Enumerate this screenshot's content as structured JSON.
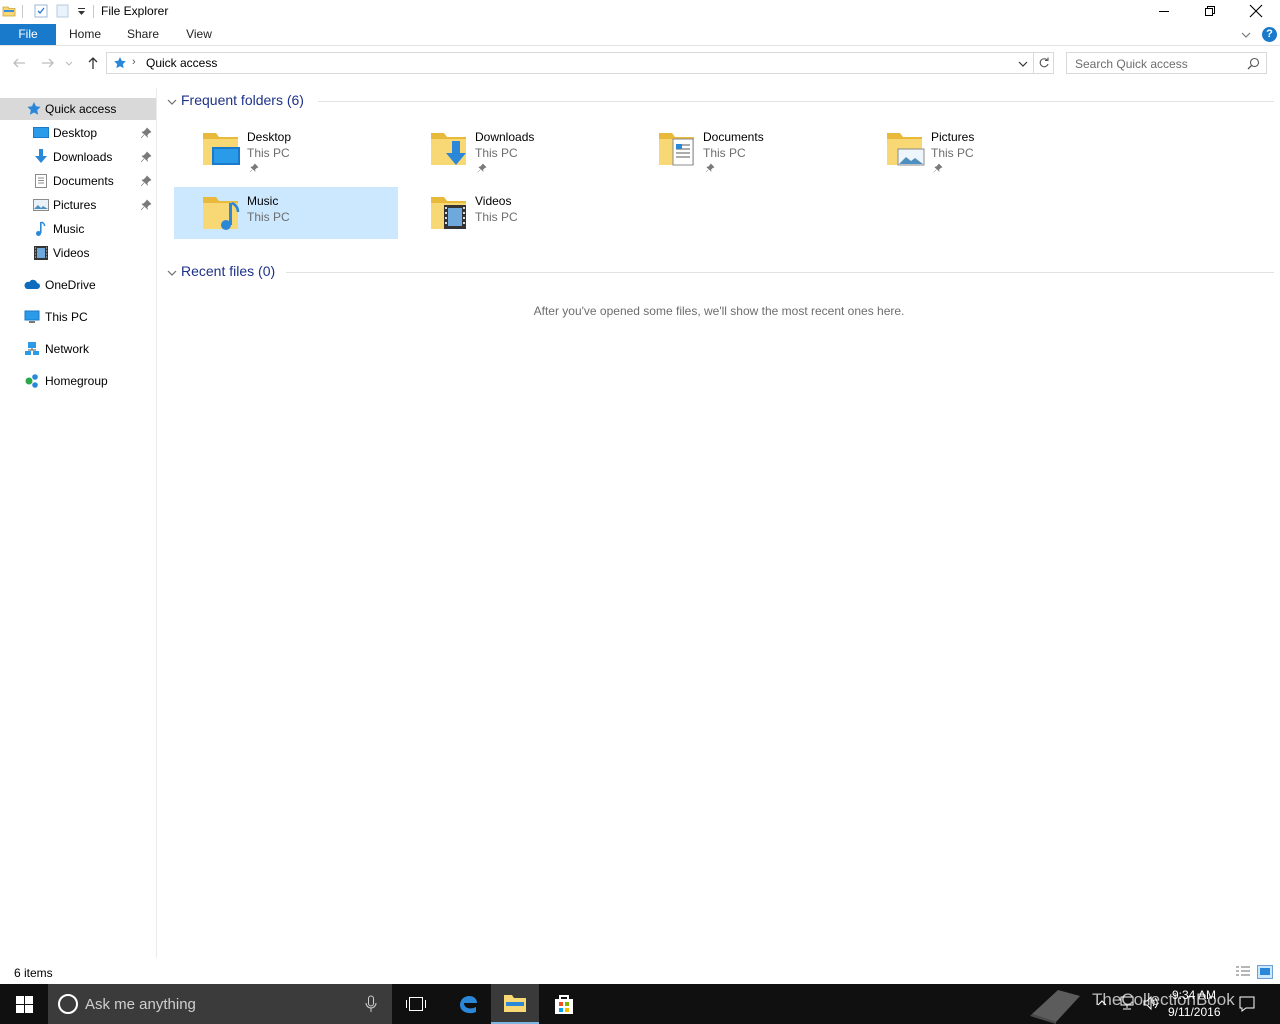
{
  "window": {
    "title": "File Explorer"
  },
  "ribbon": {
    "tabs": [
      {
        "label": "File",
        "active": true
      },
      {
        "label": "Home"
      },
      {
        "label": "Share"
      },
      {
        "label": "View"
      }
    ],
    "help_label": "?"
  },
  "address": {
    "path": "Quick access",
    "separator": "›",
    "search_placeholder": "Search Quick access"
  },
  "navpane": {
    "items": [
      {
        "label": "Quick access",
        "icon": "star-icon",
        "selected": true
      },
      {
        "label": "Desktop",
        "icon": "desktop-icon",
        "pinned": true
      },
      {
        "label": "Downloads",
        "icon": "download-arrow-icon",
        "pinned": true
      },
      {
        "label": "Documents",
        "icon": "document-icon",
        "pinned": true
      },
      {
        "label": "Pictures",
        "icon": "picture-icon",
        "pinned": true
      },
      {
        "label": "Music",
        "icon": "music-note-icon"
      },
      {
        "label": "Videos",
        "icon": "film-icon"
      },
      {
        "label": "OneDrive",
        "icon": "cloud-icon"
      },
      {
        "label": "This PC",
        "icon": "computer-icon"
      },
      {
        "label": "Network",
        "icon": "network-icon"
      },
      {
        "label": "Homegroup",
        "icon": "homegroup-icon"
      }
    ]
  },
  "content": {
    "frequent_title": "Frequent folders (6)",
    "recent_title": "Recent files (0)",
    "recent_empty": "After you've opened some files, we'll show the most recent ones here.",
    "folders": [
      {
        "name": "Desktop",
        "location": "This PC",
        "pinned": true,
        "overlay": "desktop"
      },
      {
        "name": "Downloads",
        "location": "This PC",
        "pinned": true,
        "overlay": "download"
      },
      {
        "name": "Documents",
        "location": "This PC",
        "pinned": true,
        "overlay": "document"
      },
      {
        "name": "Pictures",
        "location": "This PC",
        "pinned": true,
        "overlay": "picture"
      },
      {
        "name": "Music",
        "location": "This PC",
        "pinned": false,
        "overlay": "music",
        "selected": true
      },
      {
        "name": "Videos",
        "location": "This PC",
        "pinned": false,
        "overlay": "video"
      }
    ]
  },
  "status": {
    "count": "6 items"
  },
  "taskbar": {
    "search_placeholder": "Ask me anything",
    "time": "9:34 AM",
    "date": "9/11/2016",
    "watermark": "TheCollectionBook"
  },
  "colors": {
    "accent": "#1979ca",
    "group_title": "#1e3287",
    "selection": "#cce8ff",
    "folder_yellow": "#f8d775",
    "taskbar": "#101010"
  }
}
